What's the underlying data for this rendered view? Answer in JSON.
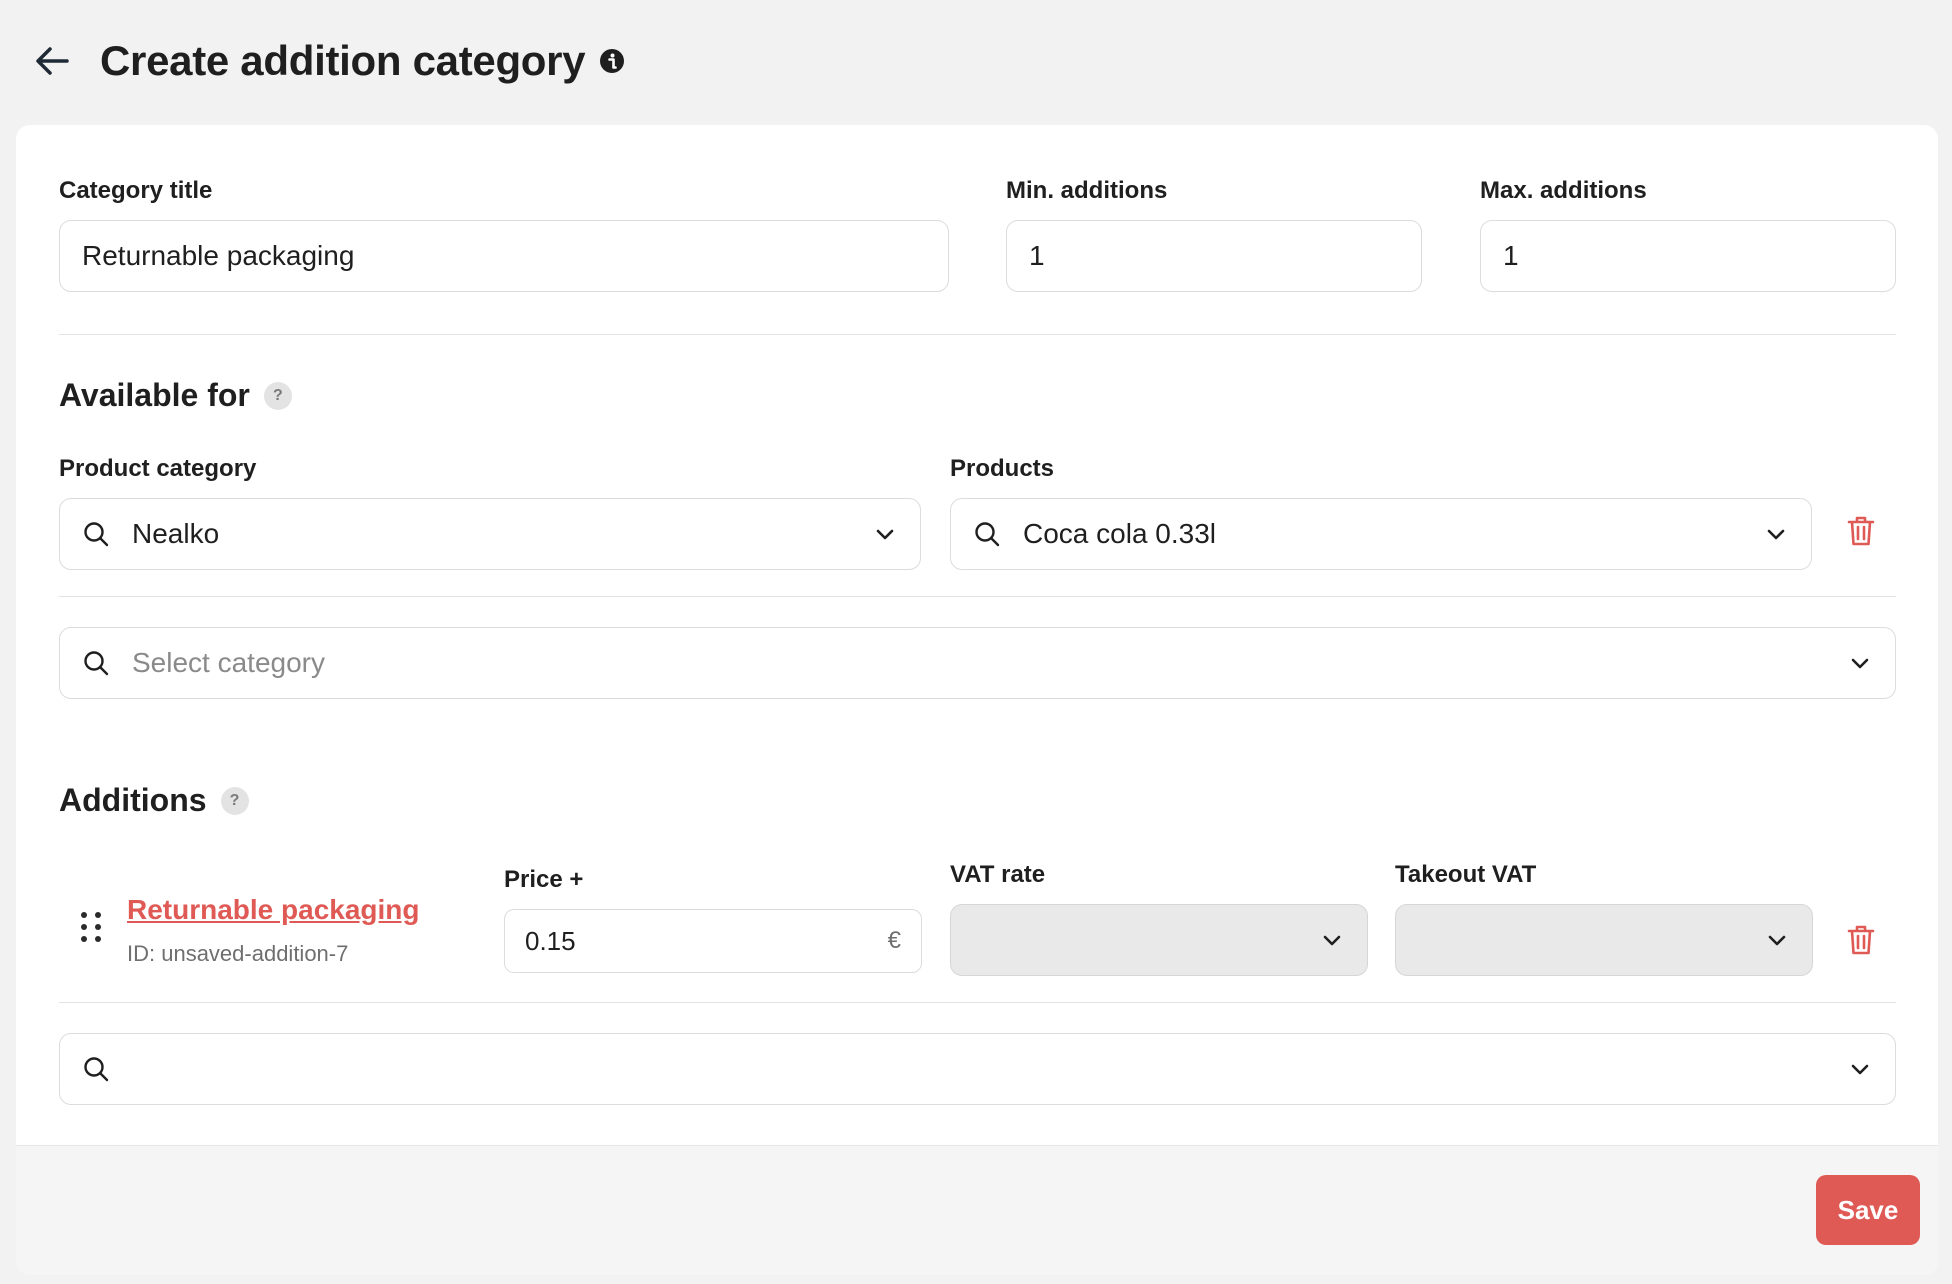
{
  "header": {
    "title": "Create addition category",
    "back_icon": "arrow-left-icon",
    "info_icon": "info-icon"
  },
  "form": {
    "category_title_label": "Category title",
    "category_title_value": "Returnable packaging",
    "min_additions_label": "Min. additions",
    "min_additions_value": "1",
    "max_additions_label": "Max. additions",
    "max_additions_value": "1"
  },
  "available_for": {
    "title": "Available for",
    "help": "?",
    "product_category_label": "Product category",
    "product_category_value": "Nealko",
    "products_label": "Products",
    "products_value": "Coca cola 0.33l",
    "new_category_placeholder": "Select category"
  },
  "additions": {
    "title": "Additions",
    "help": "?",
    "price_label": "Price +",
    "vat_rate_label": "VAT rate",
    "takeout_vat_label": "Takeout VAT",
    "items": [
      {
        "name": "Returnable packaging",
        "id_text": "ID: unsaved-addition-7",
        "price": "0.15",
        "currency": "€",
        "vat_rate": "",
        "takeout_vat": ""
      }
    ],
    "new_addition_value": ""
  },
  "footer": {
    "save_label": "Save"
  },
  "colors": {
    "accent": "#e05a55",
    "background": "#f2f2f2",
    "card": "#ffffff"
  }
}
